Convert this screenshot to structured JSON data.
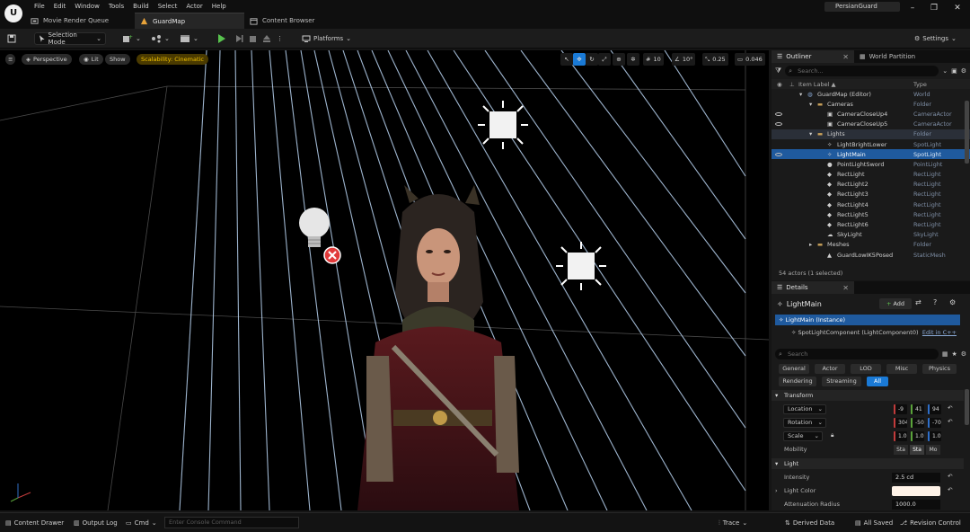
{
  "menu": [
    "File",
    "Edit",
    "Window",
    "Tools",
    "Build",
    "Select",
    "Actor",
    "Help"
  ],
  "doc_tabs": [
    {
      "label": "Movie Render Queue",
      "icon": "render-queue-icon",
      "active": false
    },
    {
      "label": "GuardMap",
      "icon": "level-icon",
      "active": true
    },
    {
      "label": "Content Browser",
      "icon": "content-browser-icon",
      "active": false
    }
  ],
  "project_name": "PersianGuard",
  "window_controls": {
    "minimize": "–",
    "maximize": "❐",
    "close": "✕"
  },
  "toolbar": {
    "selection_mode": "Selection Mode",
    "platforms": "Platforms",
    "settings": "Settings"
  },
  "viewport": {
    "perspective": "Perspective",
    "lit": "Lit",
    "show": "Show",
    "scalability": "Scalability: Cinematic",
    "grid_snap": "10",
    "rotation_snap": "10°",
    "scale_snap": "0.25",
    "camera_speed": "0.046"
  },
  "outliner": {
    "tab_label": "Outliner",
    "world_partition_label": "World Partition",
    "search_placeholder": "Search...",
    "col_item_label": "Item Label ▲",
    "col_type": "Type",
    "rows": [
      {
        "label": "GuardMap (Editor)",
        "type": "World",
        "indent": 0,
        "icon": "world-icon"
      },
      {
        "label": "Cameras",
        "type": "Folder",
        "indent": 1,
        "icon": "folder-icon"
      },
      {
        "label": "CameraCloseUp4",
        "type": "CameraActor",
        "indent": 2,
        "icon": "camera-icon"
      },
      {
        "label": "CameraCloseUp5",
        "type": "CameraActor",
        "indent": 2,
        "icon": "camera-icon"
      },
      {
        "label": "Lights",
        "type": "Folder",
        "indent": 1,
        "icon": "folder-icon"
      },
      {
        "label": "LightBrightLower",
        "type": "SpotLight",
        "indent": 2,
        "icon": "spotlight-icon"
      },
      {
        "label": "LightMain",
        "type": "SpotLight",
        "indent": 2,
        "icon": "spotlight-icon"
      },
      {
        "label": "PointLightSword",
        "type": "PointLight",
        "indent": 2,
        "icon": "pointlight-icon"
      },
      {
        "label": "RectLight",
        "type": "RectLight",
        "indent": 2,
        "icon": "rectlight-icon"
      },
      {
        "label": "RectLight2",
        "type": "RectLight",
        "indent": 2,
        "icon": "rectlight-icon"
      },
      {
        "label": "RectLight3",
        "type": "RectLight",
        "indent": 2,
        "icon": "rectlight-icon"
      },
      {
        "label": "RectLight4",
        "type": "RectLight",
        "indent": 2,
        "icon": "rectlight-icon"
      },
      {
        "label": "RectLight5",
        "type": "RectLight",
        "indent": 2,
        "icon": "rectlight-icon"
      },
      {
        "label": "RectLight6",
        "type": "RectLight",
        "indent": 2,
        "icon": "rectlight-icon"
      },
      {
        "label": "SkyLight",
        "type": "SkyLight",
        "indent": 2,
        "icon": "skylight-icon"
      },
      {
        "label": "Meshes",
        "type": "Folder",
        "indent": 1,
        "icon": "folder-icon"
      },
      {
        "label": "GuardLowIK5Posed",
        "type": "StaticMesh",
        "indent": 2,
        "icon": "mesh-icon"
      }
    ],
    "footer": "54 actors (1 selected)"
  },
  "details": {
    "tab_label": "Details",
    "actor_name": "LightMain",
    "add_label": "Add",
    "instance_label": "LightMain (Instance)",
    "component_label": "SpotLightComponent (LightComponent0)",
    "edit_cpp": "Edit in C++",
    "search_placeholder": "Search",
    "categories": [
      "General",
      "Actor",
      "LOD",
      "Misc",
      "Physics",
      "Rendering",
      "Streaming",
      "All"
    ],
    "transform_header": "Transform",
    "location_label": "Location",
    "location": [
      "-9",
      "41",
      "94"
    ],
    "rotation_label": "Rotation",
    "rotation": [
      "304",
      "-50",
      "-70"
    ],
    "scale_label": "Scale",
    "scale": [
      "1.0",
      "1.0",
      "1.0"
    ],
    "mobility_label": "Mobility",
    "mobility_options": [
      "Sta",
      "Sta",
      "Mo"
    ],
    "light_header": "Light",
    "intensity_label": "Intensity",
    "intensity": "2.5 cd",
    "light_color_label": "Light Color",
    "light_color": "#fff3e8",
    "attenuation_label": "Attenuation Radius",
    "attenuation": "1000.0"
  },
  "statusbar": {
    "content_drawer": "Content Drawer",
    "output_log": "Output Log",
    "cmd": "Cmd",
    "console_placeholder": "Enter Console Command",
    "trace": "Trace",
    "derived_data": "Derived Data",
    "all_saved": "All Saved",
    "revision_control": "Revision Control"
  }
}
